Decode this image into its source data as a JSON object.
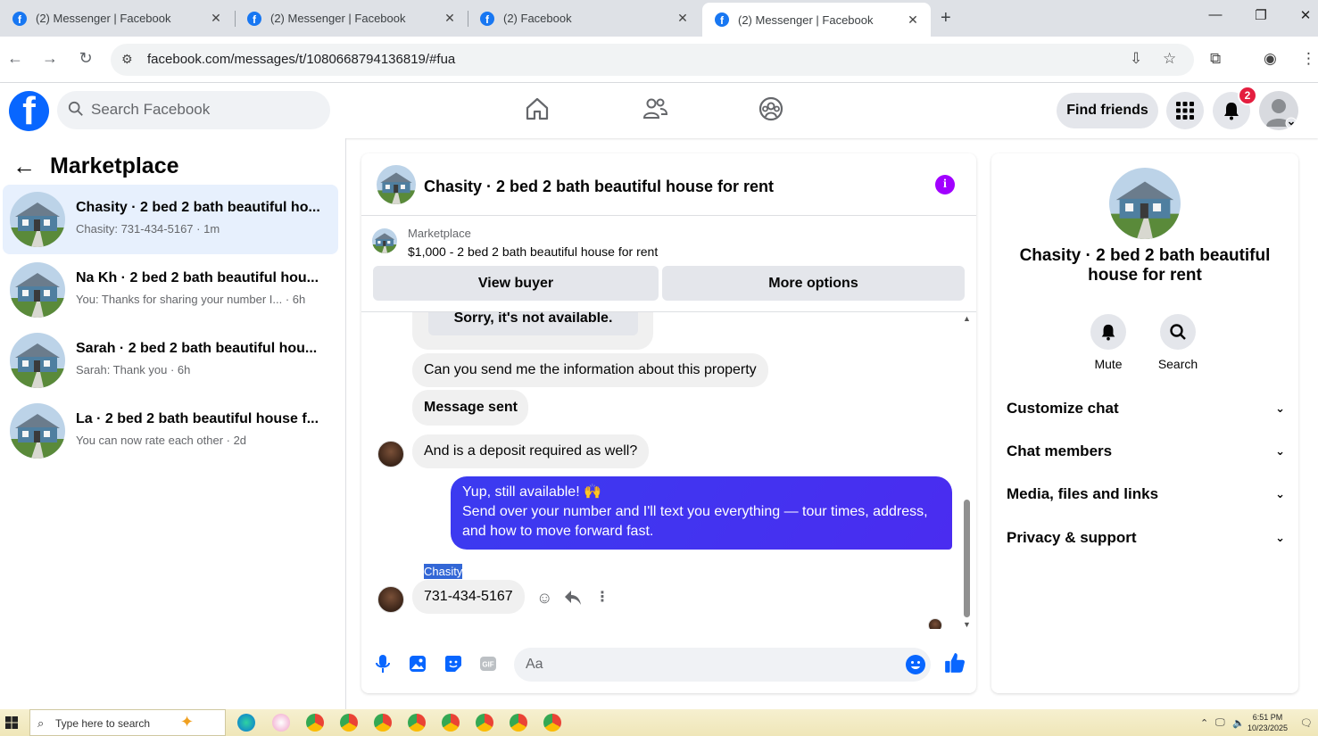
{
  "browser": {
    "tabs": [
      {
        "title": "(2) Messenger | Facebook"
      },
      {
        "title": "(2) Messenger | Facebook"
      },
      {
        "title": "(2) Facebook"
      },
      {
        "title": "(2) Messenger | Facebook"
      }
    ],
    "url": "facebook.com/messages/t/1080668794136819/#fua"
  },
  "fb": {
    "search_placeholder": "Search Facebook",
    "find_friends": "Find friends",
    "notif_count": "2"
  },
  "sidebar": {
    "title": "Marketplace",
    "conversations": [
      {
        "name": "Chasity · 2 bed 2 bath beautiful ho...",
        "sub": "Chasity: 731-434-5167 · 1m"
      },
      {
        "name": "Na Kh · 2 bed 2 bath beautiful hou...",
        "sub": "You: Thanks for sharing your number I... · 6h"
      },
      {
        "name": "Sarah · 2 bed 2 bath beautiful hou...",
        "sub": "Sarah: Thank you · 6h"
      },
      {
        "name": "La · 2 bed 2 bath beautiful house f...",
        "sub": "You can now rate each other · 2d"
      }
    ]
  },
  "chat": {
    "header_name": "Chasity · 2 bed 2 bath beautiful house for rent",
    "info_icon": "i",
    "listing_label": "Marketplace",
    "listing_price": "$1,000 - 2 bed 2 bath beautiful house for rent",
    "view_buyer": "View buyer",
    "more_options": "More options",
    "messages": {
      "m1": "Sorry, it's not available.",
      "m2": "Can you send me the information about this property",
      "m3": "Message sent",
      "m4": "And is a deposit required as well?",
      "m5_line1": "Yup, still available! 🙌",
      "m5_line2": "Send over your number and I'll text you everything — tour times, address, and how to move forward fast.",
      "sender": "Chasity",
      "m6": "731-434-5167"
    },
    "composer_placeholder": "Aa"
  },
  "info_panel": {
    "name": "Chasity · 2 bed 2 bath beautiful house for rent",
    "mute": "Mute",
    "search": "Search",
    "sections": [
      "Customize chat",
      "Chat members",
      "Media, files and links",
      "Privacy & support"
    ]
  },
  "taskbar": {
    "search_placeholder": "Type here to search",
    "time": "6:51 PM",
    "date": "10/23/2025"
  },
  "colors": {
    "fb_blue": "#0866ff",
    "my_bubble": "#3b3bf0",
    "info_purple": "#a100ff",
    "active_conv": "#e7f0fd"
  }
}
